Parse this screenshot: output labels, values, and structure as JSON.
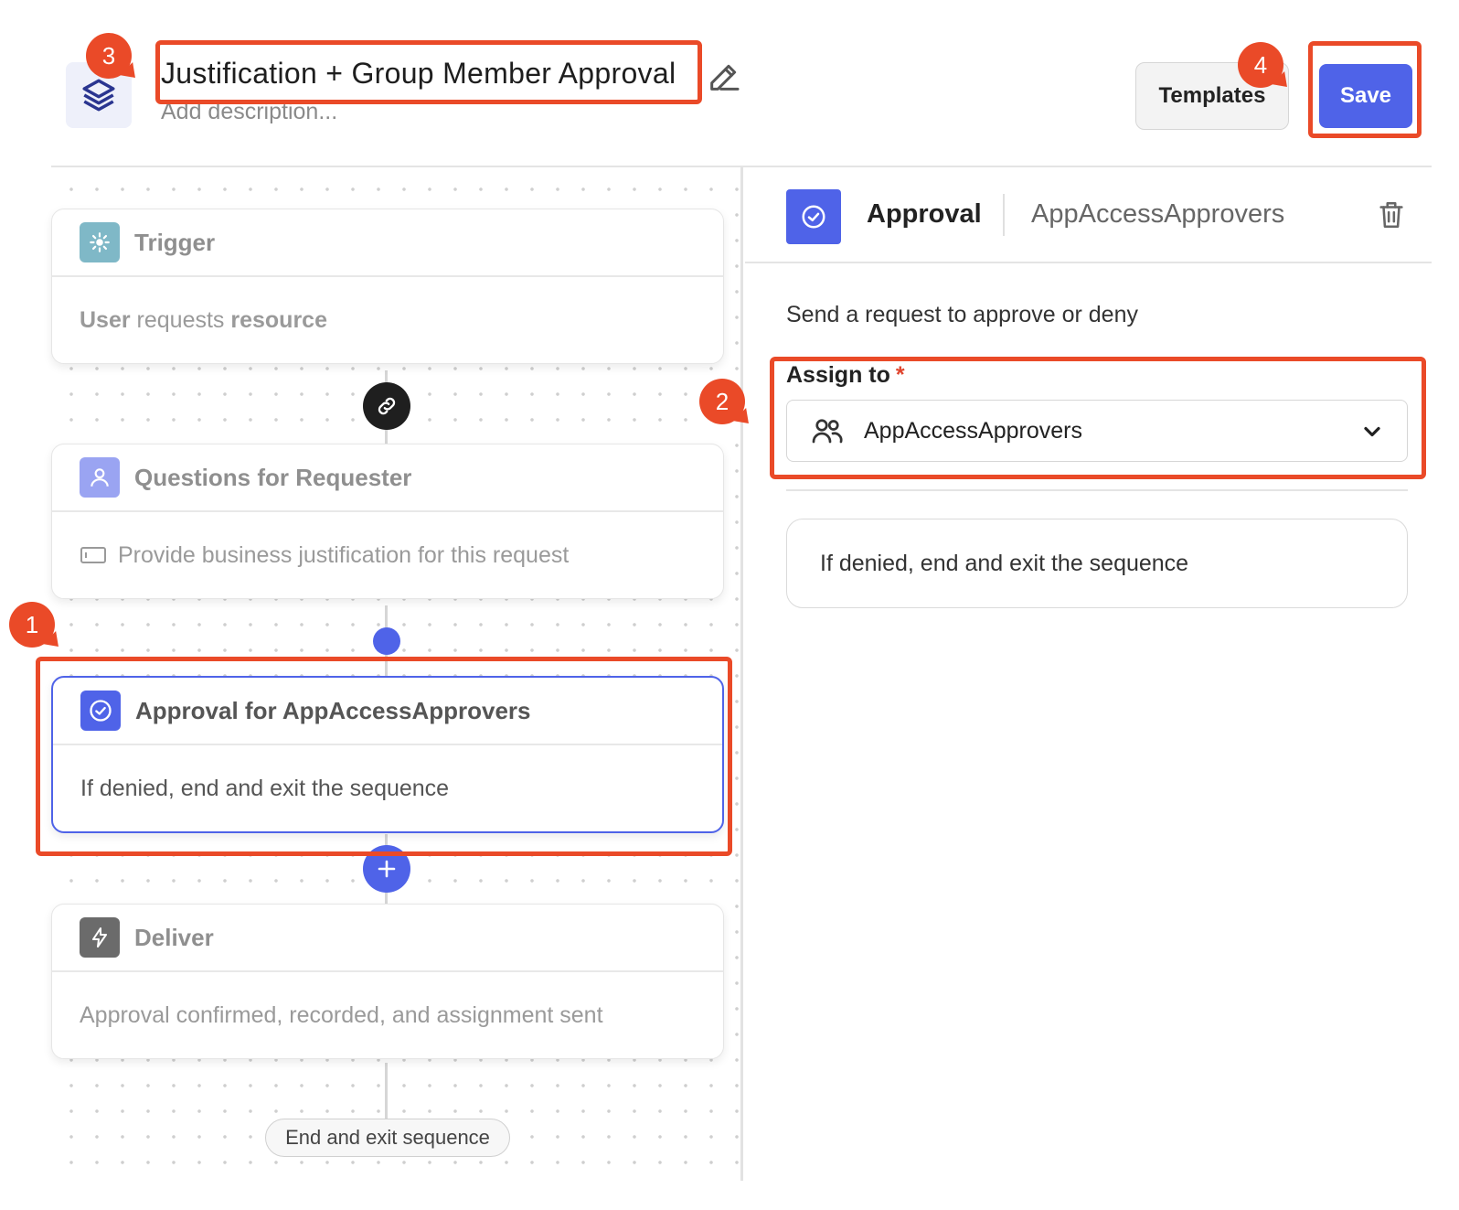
{
  "header": {
    "title": "Justification + Group Member Approval",
    "description_placeholder": "Add description...",
    "templates_label": "Templates",
    "save_label": "Save"
  },
  "workflow": {
    "steps": [
      {
        "title": "Trigger",
        "body_parts": [
          "User",
          " requests ",
          "resource"
        ],
        "icon": "trigger-sparkle-icon",
        "icon_color": "#7fb8c7"
      },
      {
        "title": "Questions for Requester",
        "body": "Provide business justification for this request",
        "icon": "person-icon",
        "icon_color": "#9aa4f2"
      },
      {
        "title": "Approval for AppAccessApprovers",
        "body": "If denied, end and exit the sequence",
        "icon": "check-circle-icon",
        "icon_color": "#4f63e8",
        "selected": true
      },
      {
        "title": "Deliver",
        "body": "Approval confirmed, recorded, and assignment sent",
        "icon": "lightning-icon",
        "icon_color": "#6b6b6b"
      }
    ],
    "end_label": "End and exit sequence"
  },
  "panel": {
    "type_label": "Approval",
    "name": "AppAccessApprovers",
    "description": "Send a request to approve or deny",
    "assign_label": "Assign to",
    "required_mark": "*",
    "assign_value": "AppAccessApprovers",
    "deny_behavior": "If denied, end and exit the sequence"
  },
  "annotations": [
    "1",
    "2",
    "3",
    "4"
  ],
  "colors": {
    "accent": "#4f63e8",
    "annotation": "#ea4a28"
  }
}
